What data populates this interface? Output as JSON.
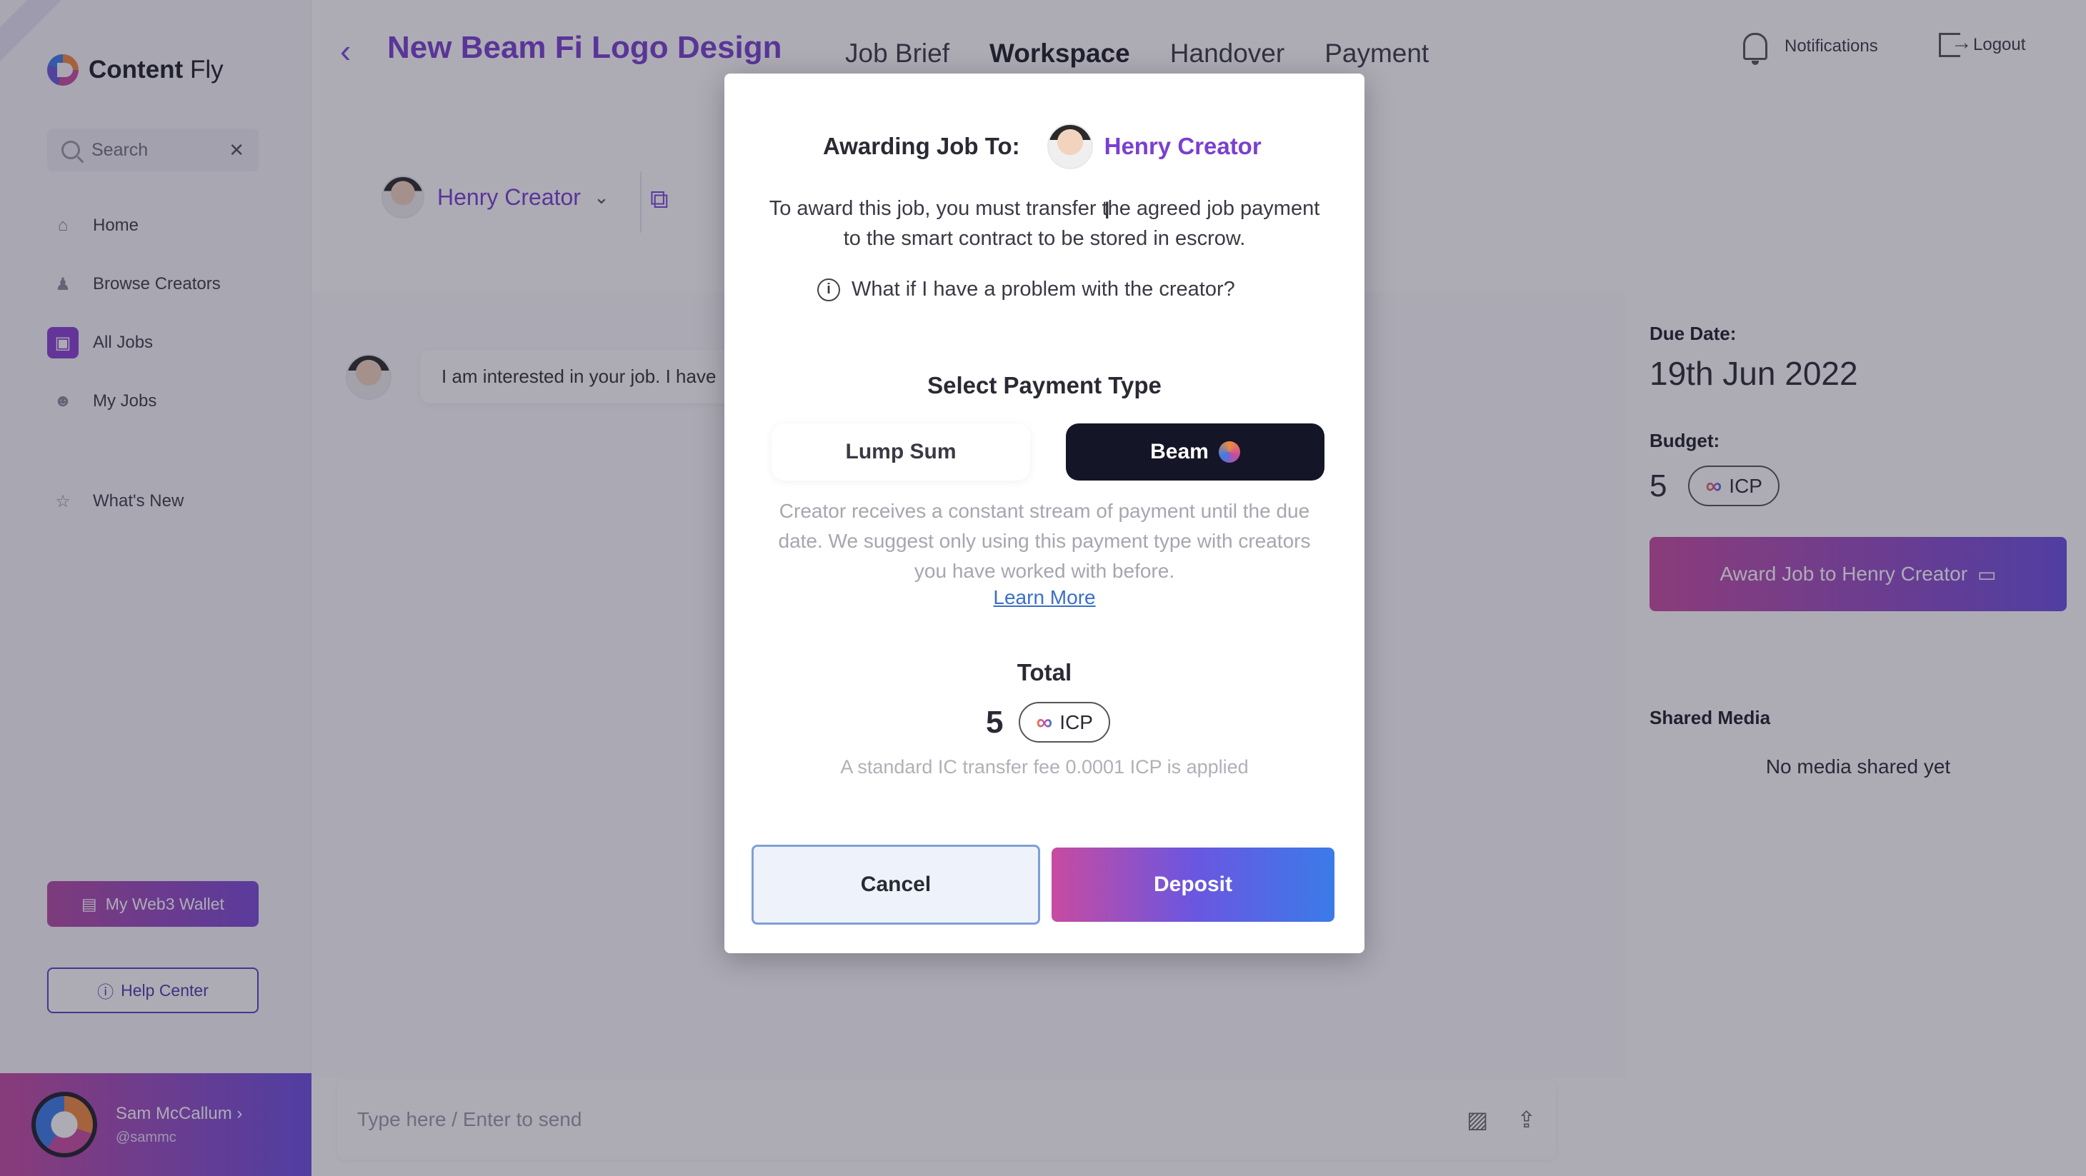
{
  "app": {
    "brand_bold": "Content",
    "brand_light": "Fly"
  },
  "search": {
    "placeholder": "Search"
  },
  "sidebar": {
    "items": [
      {
        "label": "Home",
        "icon": "home-icon"
      },
      {
        "label": "Browse Creators",
        "icon": "people-icon"
      },
      {
        "label": "All Jobs",
        "icon": "briefcase-icon",
        "active": true
      },
      {
        "label": "My Jobs",
        "icon": "user-icon"
      },
      {
        "label": "What's New",
        "icon": "star-icon"
      }
    ],
    "wallet_label": "My Web3 Wallet",
    "help_label": "Help Center"
  },
  "user": {
    "name": "Sam McCallum",
    "handle": "@sammc"
  },
  "header": {
    "title": "New Beam Fi Logo Design",
    "tabs": [
      "Job Brief",
      "Workspace",
      "Handover",
      "Payment"
    ],
    "active_tab": "Workspace",
    "notifications_label": "Notifications",
    "logout_label": "Logout"
  },
  "creator": {
    "name": "Henry Creator"
  },
  "chat": {
    "message_preview": "I am interested in your job. I have",
    "composer_placeholder": "Type here / Enter to send"
  },
  "panel": {
    "due_label": "Due Date:",
    "due_date": "19th Jun 2022",
    "budget_label": "Budget:",
    "budget_amount": "5",
    "currency": "ICP",
    "award_button": "Award Job to Henry Creator",
    "shared_media_label": "Shared Media",
    "no_media": "No media shared yet"
  },
  "modal": {
    "awarding_label": "Awarding Job To:",
    "creator_name": "Henry Creator",
    "description": "To award this job, you must transfer the agreed job payment to the smart contract to be stored in escrow.",
    "problem_link": "What if I have a problem with the creator?",
    "payment_type_heading": "Select Payment Type",
    "options": [
      "Lump Sum",
      "Beam"
    ],
    "selected_option": "Beam",
    "beam_description": "Creator receives a constant stream of payment until the due date. We suggest only using this payment type with creators you have worked with before.",
    "learn_more": "Learn More",
    "total_label": "Total",
    "total_amount": "5",
    "currency": "ICP",
    "fee_note": "A standard IC transfer fee 0.0001 ICP is applied",
    "cancel_label": "Cancel",
    "deposit_label": "Deposit"
  },
  "colors": {
    "accent_purple": "#7a3fd0",
    "gradient_start": "#c84ba0",
    "gradient_end": "#3b7be8",
    "beam_selected": "#141526"
  }
}
